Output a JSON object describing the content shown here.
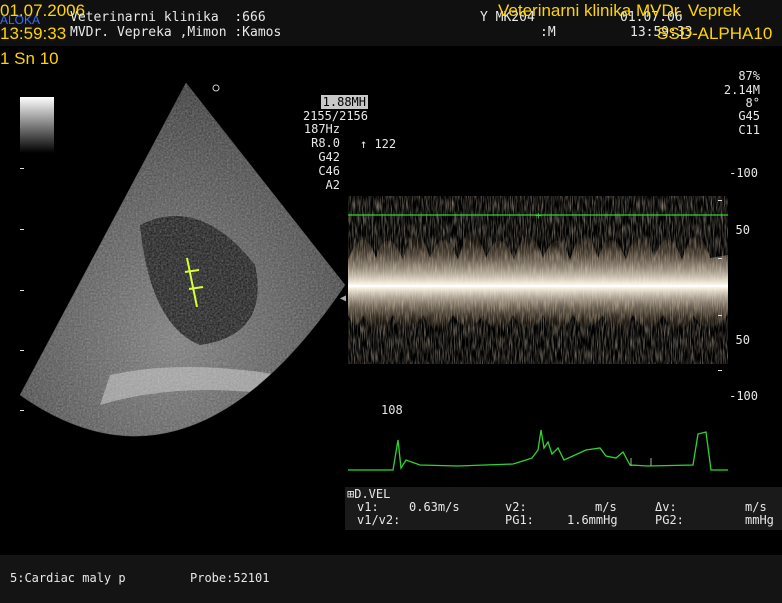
{
  "header": {
    "date": "01.07.2006",
    "time": "13:59:33",
    "overlay_left": "ALOKA",
    "clinic_line": "Veterinarni klinika  :666",
    "doctor_line": "MVDr. Vepreka ,Mimon :Kamos",
    "id_line": "Y MK204",
    "sex_line": ":M",
    "date_small": "01.07.06",
    "time_small": "13:59:33",
    "clinic_title": "Veterinarni klinika MVDr. Veprek",
    "device": "SSD-ALPHA10"
  },
  "image_mode": "1 Sn 10",
  "bmode_params": {
    "freq": "1.88MH",
    "depth": "2155/2156",
    "prf": "187Hz",
    "range": "R8.0",
    "gain": "G42",
    "contrast": "C46",
    "area": "A2",
    "marker": "↑ 122"
  },
  "doppler_params": {
    "power": "87%",
    "freq": "2.14M",
    "angle": "8°",
    "gain": "G45",
    "contrast": "C11"
  },
  "velocity_scale": [
    "-100",
    "50",
    "50",
    "-100"
  ],
  "heart_rate": "108",
  "dvel": {
    "title": "D.VEL",
    "v1_label": "v1:",
    "v1_value": "0.63m/s",
    "v2_label": "v2:",
    "v2_unit": "m/s",
    "dv_label": "Δv:",
    "dv_unit": "m/s",
    "ratio_label": "v1/v2:",
    "pg1_label": "PG1:",
    "pg1_value": "1.6mmHg",
    "pg2_label": "PG2:",
    "pg2_unit": "mmHg"
  },
  "footer": {
    "preset": "5:Cardiac maly p",
    "probe": "Probe:52101"
  },
  "colors": {
    "header_yellow": "#ffd400",
    "trace_green": "#2fd52f",
    "cursor_yellow": "#d6ff3a"
  }
}
